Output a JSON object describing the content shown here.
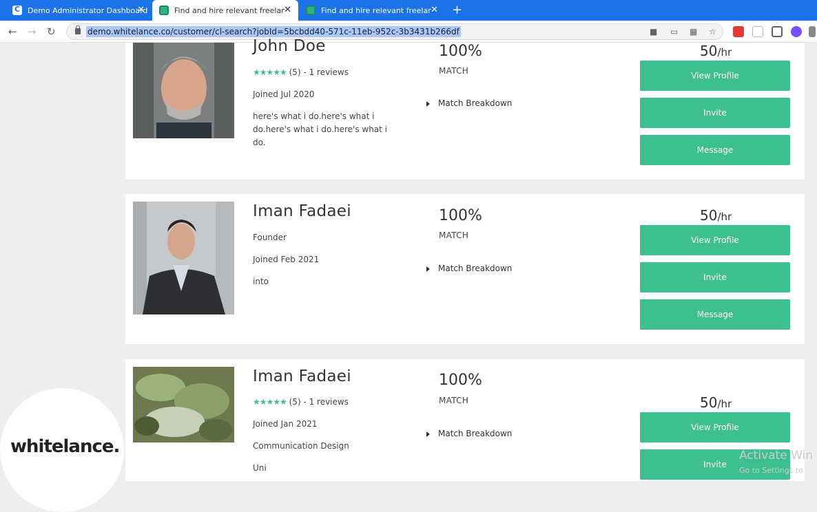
{
  "browser": {
    "tabs": [
      {
        "title": "Demo Administrator Dashboard",
        "close": "✕"
      },
      {
        "title": "Find and hire relevant freelancer",
        "close": "✕"
      },
      {
        "title": "Find and hire relevant freelancer",
        "close": "✕"
      }
    ],
    "new_tab": "+",
    "url": "demo.whitelance.co/customer/cl-search?jobId=5bcbdd40-571c-11eb-952c-3b3431b266df",
    "nav": {
      "back": "←",
      "forward": "→",
      "reload": "↻"
    }
  },
  "freelancers": [
    {
      "name": "John Doe",
      "stars": "★★★★★",
      "rating_text": "(5) - 1 reviews",
      "joined": "Joined Jul 2020",
      "description": "here's what i do.here's what i do.here's what i do.here's what i do.",
      "match_pct": "100%",
      "match_label": "MATCH",
      "breakdown": "Match Breakdown",
      "rate": "50",
      "rate_unit": "/hr",
      "buttons": [
        "View Profile",
        "Invite",
        "Message"
      ]
    },
    {
      "name": "Iman Fadaei",
      "headline": "Founder",
      "joined": "Joined Feb 2021",
      "description": "into",
      "match_pct": "100%",
      "match_label": "MATCH",
      "breakdown": "Match Breakdown",
      "rate": "50",
      "rate_unit": "/hr",
      "buttons": [
        "View Profile",
        "Invite",
        "Message"
      ]
    },
    {
      "name": "Iman Fadaei",
      "stars": "★★★★★",
      "rating_text": "(5) - 1 reviews",
      "joined": "Joined Jan 2021",
      "headline": "Communication Design",
      "description": "Uni",
      "match_pct": "100%",
      "match_label": "MATCH",
      "breakdown": "Match Breakdown",
      "rate": "50",
      "rate_unit": "/hr",
      "buttons": [
        "View Profile",
        "Invite"
      ]
    }
  ],
  "brand": {
    "logo": "whitelance.",
    "accent": "#3dbf8f"
  },
  "watermark": {
    "line1": "Activate Win",
    "line2": "Go to Settings to"
  }
}
